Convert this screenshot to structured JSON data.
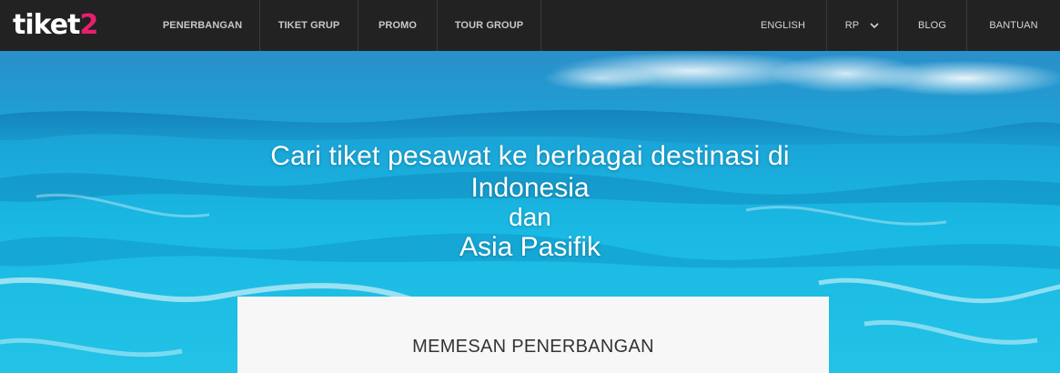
{
  "header": {
    "logo": {
      "main": "tiket",
      "accent": "2"
    },
    "nav_left": [
      {
        "label": "PENERBANGAN"
      },
      {
        "label": "TIKET GRUP"
      },
      {
        "label": "PROMO"
      },
      {
        "label": "TOUR GROUP"
      }
    ],
    "nav_right": [
      {
        "label": "ENGLISH"
      },
      {
        "label": "RP"
      },
      {
        "label": "BLOG"
      },
      {
        "label": "BANTUAN"
      }
    ],
    "currency_icon": "chevron-down-icon"
  },
  "hero": {
    "line1": "Cari tiket pesawat ke berbagai destinasi di",
    "line2": "Indonesia",
    "line3": "dan",
    "line4": "Asia Pasifik"
  },
  "booking": {
    "title": "MEMESAN PENERBANGAN"
  },
  "colors": {
    "topbar": "#222222",
    "logo_accent": "#e6206e",
    "sea": "#19b9e3"
  }
}
